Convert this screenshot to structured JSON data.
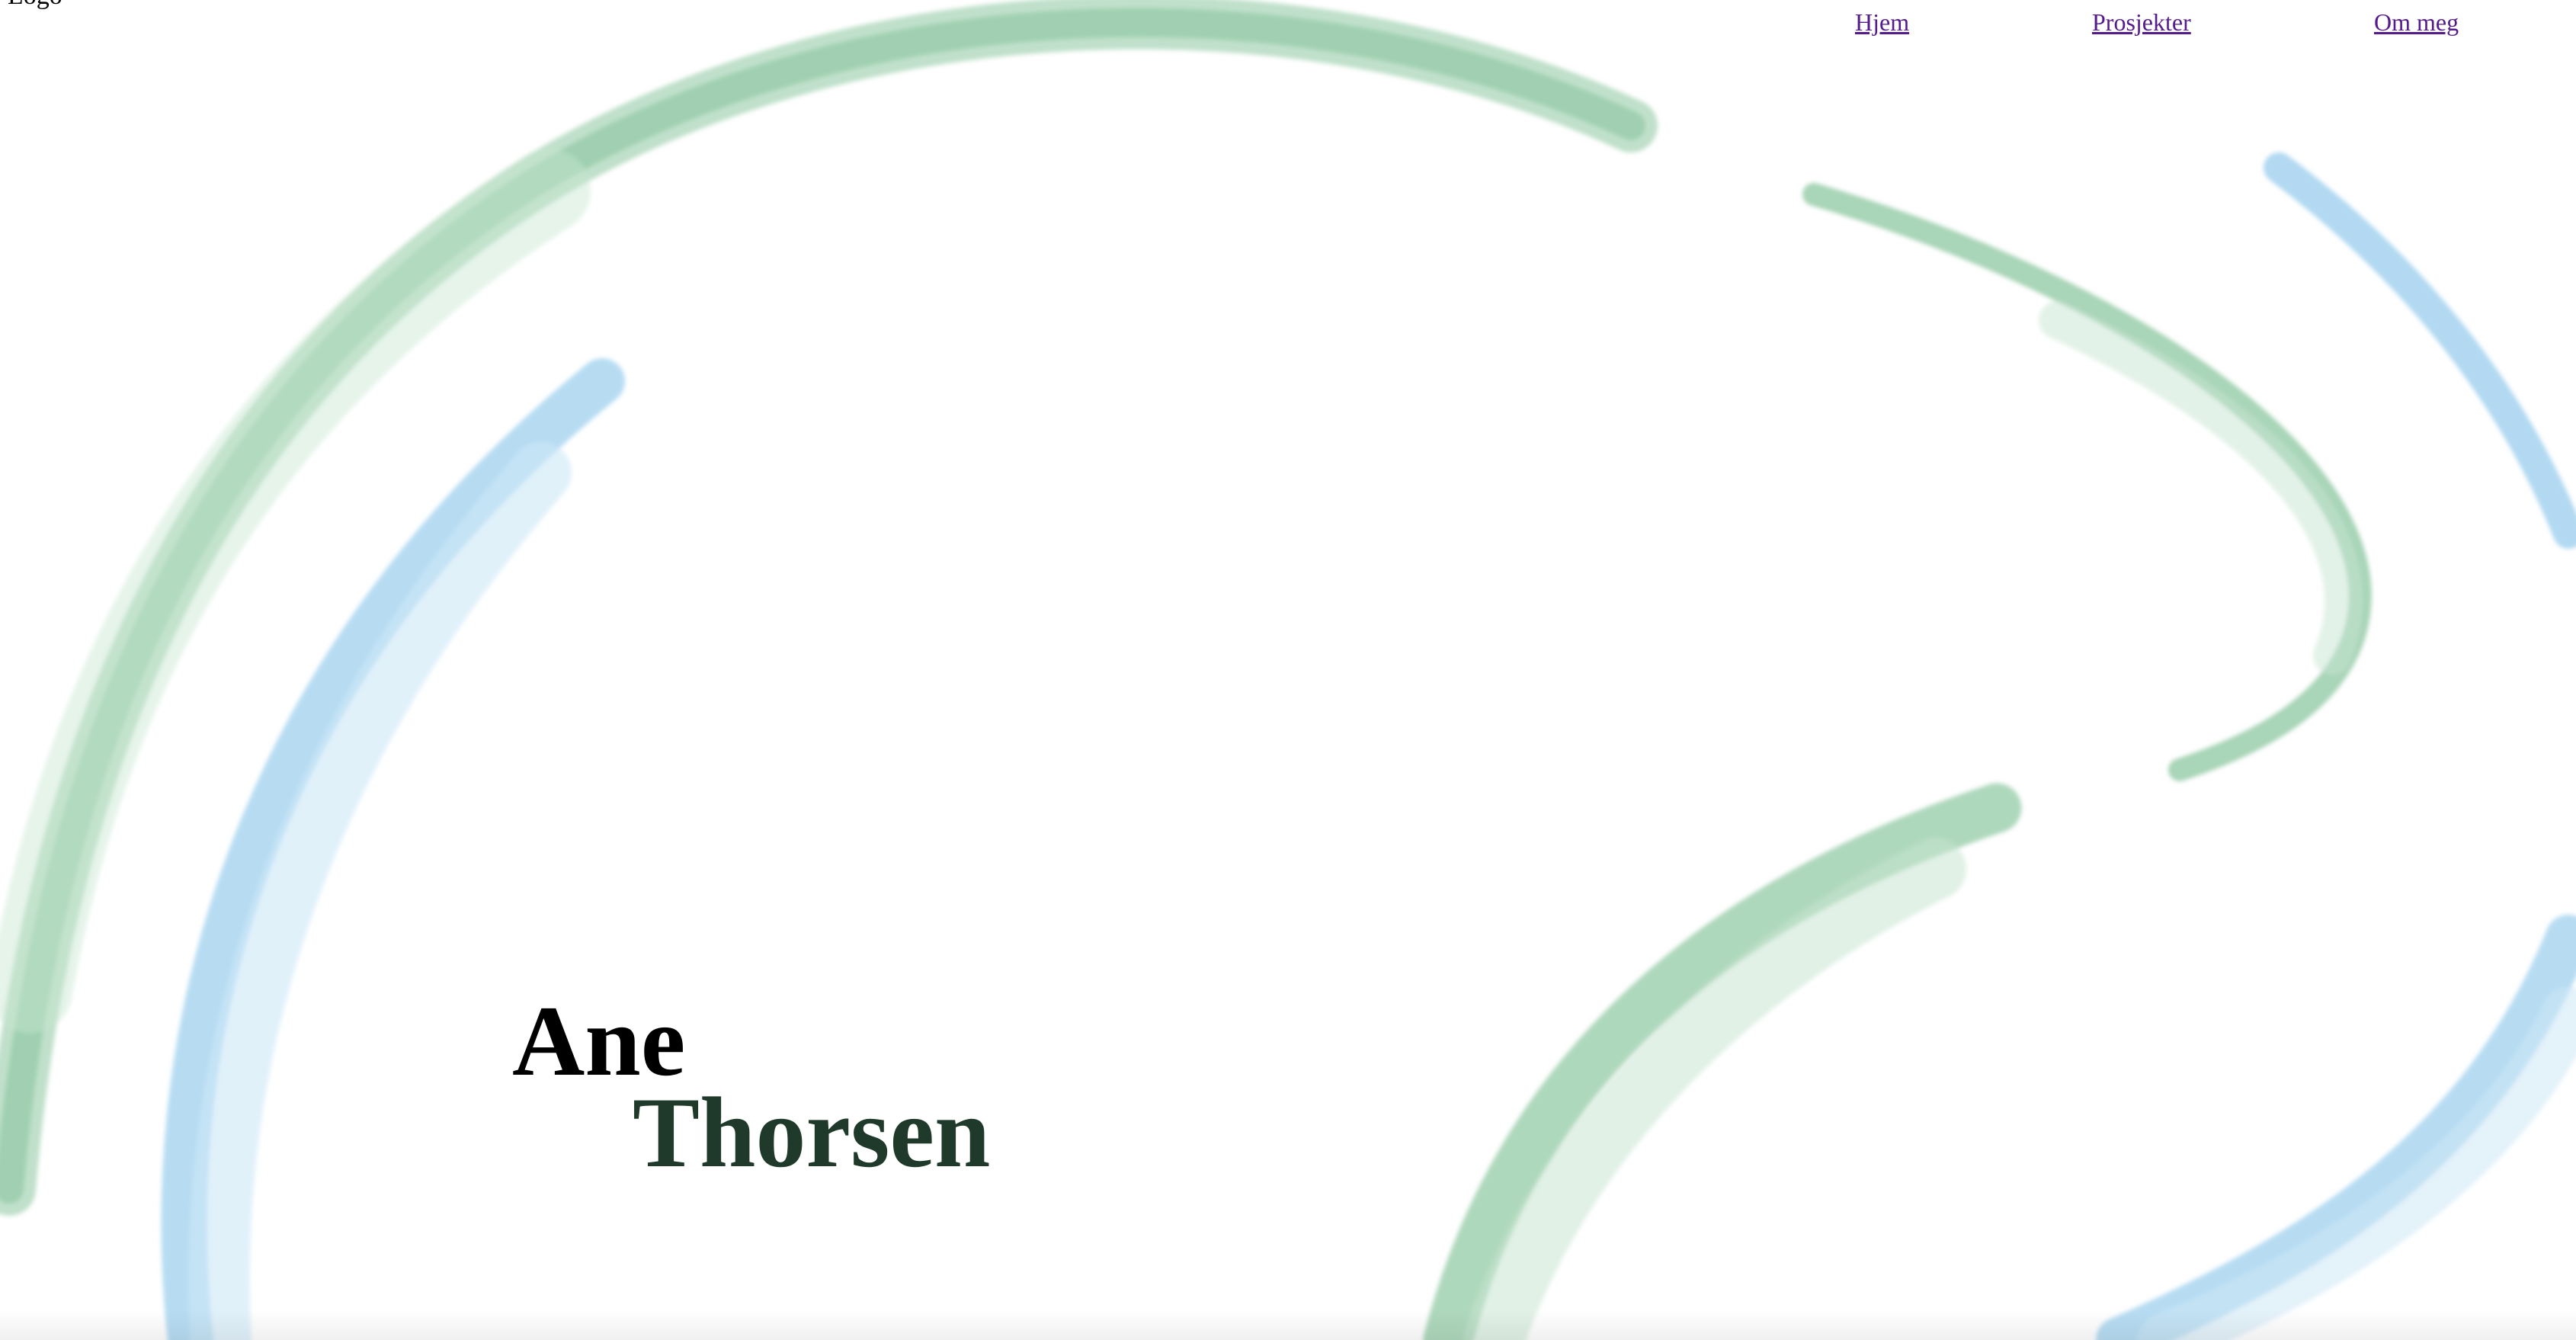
{
  "header": {
    "logo_text": "Logo"
  },
  "nav": {
    "items": [
      {
        "label": "Hjem"
      },
      {
        "label": "Prosjekter"
      },
      {
        "label": "Om meg"
      }
    ]
  },
  "hero": {
    "first_name": "Ane",
    "last_name": "Thorsen"
  },
  "colors": {
    "brush_green": "#8cc7a0",
    "brush_blue": "#9fd0ee",
    "last_name_color": "#1f3a2a",
    "link_visited": "#551a8b"
  },
  "decorations": {
    "background_icon": "watercolor-brush-strokes"
  }
}
